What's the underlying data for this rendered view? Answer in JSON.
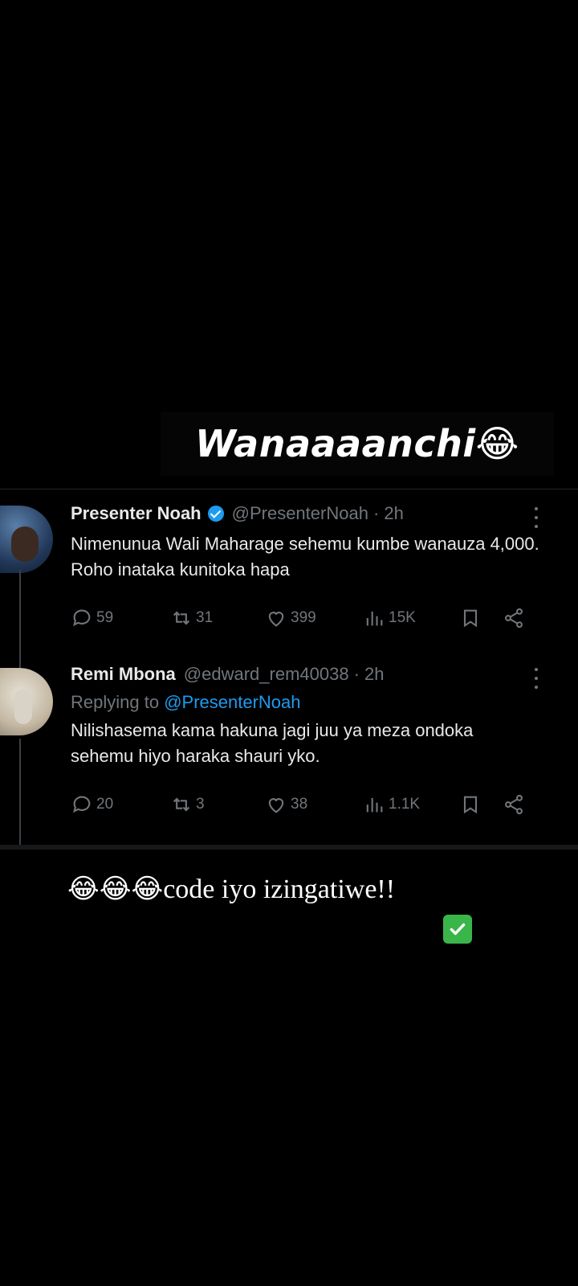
{
  "headline": {
    "text": "Wanaaaanchi",
    "emoji": "😂"
  },
  "thread": {
    "tweets": [
      {
        "author": "Presenter Noah",
        "verified": true,
        "handle": "@PresenterNoah",
        "time": "· 2h",
        "text": "Nimenunua Wali Maharage sehemu kumbe wanauza 4,000. Roho inataka kunitoka hapa",
        "replies": "59",
        "retweets": "31",
        "likes": "399",
        "views": "15K"
      },
      {
        "author": "Remi Mbona",
        "verified": false,
        "handle": "@edward_rem40038",
        "time": "· 2h",
        "replying_label": "Replying to",
        "replying_to": "@PresenterNoah",
        "text": "Nilishasema kama hakuna jagi juu ya meza ondoka sehemu hiyo haraka shauri yko.",
        "replies": "20",
        "retweets": "3",
        "likes": "38",
        "views": "1.1K"
      }
    ]
  },
  "caption": {
    "emojis": "😂😂😂",
    "text": "code iyo izingatiwe!!"
  },
  "icons": {
    "reply": "comment-icon",
    "retweet": "retweet-icon",
    "like": "heart-icon",
    "views": "views-icon",
    "bookmark": "bookmark-icon",
    "share": "share-icon",
    "check": "check-mark-icon"
  },
  "colors": {
    "accent": "#1d9bf0",
    "muted": "#71767b",
    "check": "#3ab54a"
  }
}
